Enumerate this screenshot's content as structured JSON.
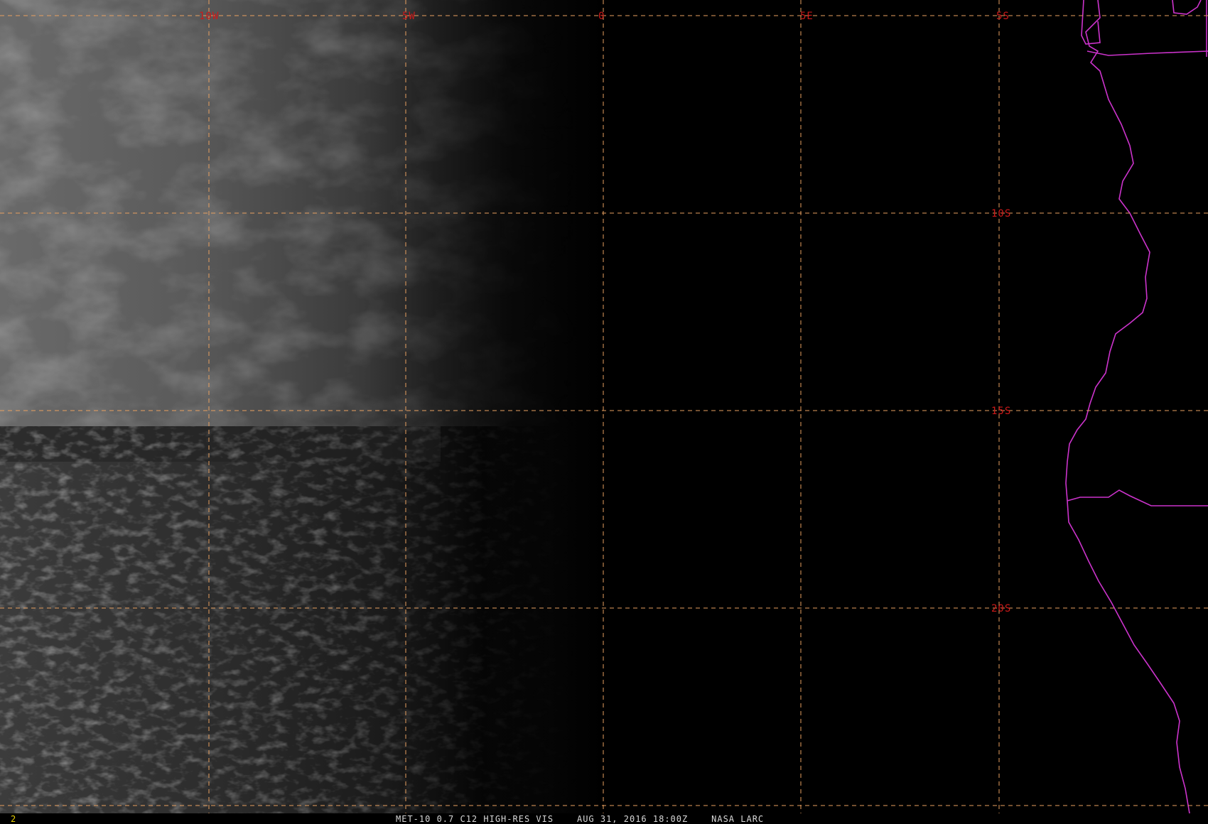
{
  "map": {
    "longitude_labels": [
      "10W",
      "5W",
      "0",
      "5E",
      "5S"
    ],
    "latitude_labels": [
      "10S",
      "15S",
      "20S"
    ],
    "grid_color": "#e8a060",
    "label_color": "#cc1a1a",
    "coastline_color": "#cc33cc"
  },
  "footer": {
    "frame_number": "2",
    "caption": "MET-10 0.7 C12 HIGH-RES VIS    AUG 31, 2016 18:00Z    NASA LARC"
  }
}
